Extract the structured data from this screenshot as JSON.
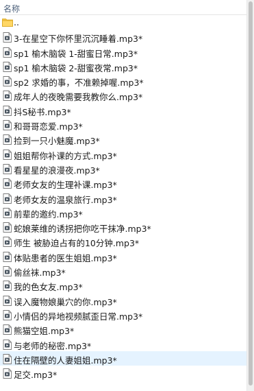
{
  "header": {
    "name_col": "名称"
  },
  "parent": {
    "label": ".."
  },
  "files": [
    "3-在星空下你怀里沉沉睡着.mp3*",
    "sp1 榆木脑袋 1-甜蜜日常.mp3*",
    "sp1 榆木脑袋 2-甜蜜夜常.mp3*",
    "sp2 求婚的事，不准赖掉喔.mp3*",
    "成年人的夜晚需要我教你么.mp3*",
    "抖S秘书.mp3*",
    "和哥哥恋爱.mp3*",
    "捡到一只小魅魔.mp3*",
    "姐姐帮你补课的方式.mp3*",
    "看星星的浪漫夜.mp3*",
    "老师女友的生理补课.mp3*",
    "老师女友的温泉旅行.mp3*",
    "前辈的邀约.mp3*",
    "蛇娘莱维的诱拐把你吃干抹净.mp3*",
    "师生 被胁迫占有的10分钟.mp3*",
    "体贴患者的医生姐姐.mp3*",
    "偷丝袜.mp3*",
    "我的色女友.mp3*",
    "误入魔物娘巢穴的你.mp3*",
    "小情侣的异地视频腻歪日常.mp3*",
    "熊猫空姐.mp3*",
    "与老师的秘密.mp3*",
    "住在隔壁的人妻姐姐.mp3*",
    "足交.mp3*"
  ],
  "selected_index": 22,
  "colors": {
    "selection": "#e5f3ff",
    "folder": "#f4c542",
    "header_text": "#4c607a"
  },
  "icons": {
    "folder": "folder-icon",
    "file": "audio-file-icon"
  }
}
